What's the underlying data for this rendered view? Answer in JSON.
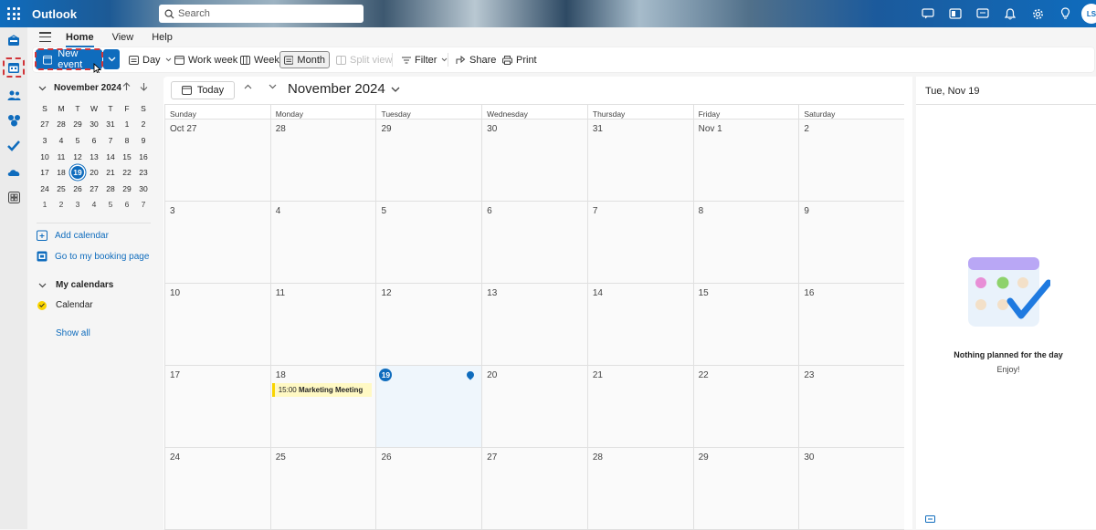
{
  "app": {
    "name": "Outlook"
  },
  "search": {
    "placeholder": "Search"
  },
  "user": {
    "initials": "LS"
  },
  "tabs": [
    {
      "label": "Home"
    },
    {
      "label": "View"
    },
    {
      "label": "Help"
    }
  ],
  "ribbon": {
    "new_event": "New event",
    "day": "Day",
    "work_week": "Work week",
    "week": "Week",
    "month": "Month",
    "split_view": "Split view",
    "filter": "Filter",
    "share": "Share",
    "print": "Print"
  },
  "mini_calendar": {
    "title": "November 2024",
    "weekday_headers": [
      "S",
      "M",
      "T",
      "W",
      "T",
      "F",
      "S"
    ],
    "weeks": [
      [
        "27",
        "28",
        "29",
        "30",
        "31",
        "1",
        "2"
      ],
      [
        "3",
        "4",
        "5",
        "6",
        "7",
        "8",
        "9"
      ],
      [
        "10",
        "11",
        "12",
        "13",
        "14",
        "15",
        "16"
      ],
      [
        "17",
        "18",
        "19",
        "20",
        "21",
        "22",
        "23"
      ],
      [
        "24",
        "25",
        "26",
        "27",
        "28",
        "29",
        "30"
      ],
      [
        "1",
        "2",
        "3",
        "4",
        "5",
        "6",
        "7"
      ]
    ],
    "today": "19"
  },
  "left_links": {
    "add_calendar": "Add calendar",
    "booking_page": "Go to my booking page",
    "my_calendars": "My calendars",
    "calendar": "Calendar",
    "show_all": "Show all"
  },
  "main": {
    "today_button": "Today",
    "month_title": "November 2024",
    "day_headers": [
      "Sunday",
      "Monday",
      "Tuesday",
      "Wednesday",
      "Thursday",
      "Friday",
      "Saturday"
    ],
    "weeks": [
      [
        "Oct 27",
        "28",
        "29",
        "30",
        "31",
        "Nov 1",
        "2"
      ],
      [
        "3",
        "4",
        "5",
        "6",
        "7",
        "8",
        "9"
      ],
      [
        "10",
        "11",
        "12",
        "13",
        "14",
        "15",
        "16"
      ],
      [
        "17",
        "18",
        "19",
        "20",
        "21",
        "22",
        "23"
      ],
      [
        "24",
        "25",
        "26",
        "27",
        "28",
        "29",
        "30"
      ]
    ],
    "today_label": "19",
    "event": {
      "time": "15:00",
      "title": "Marketing Meeting"
    }
  },
  "day_panel": {
    "title": "Tue, Nov 19",
    "empty_title": "Nothing planned for the day",
    "empty_sub": "Enjoy!"
  },
  "colors": {
    "accent": "#0f6cbd",
    "alert": "#d13438",
    "event": "#f9d400"
  }
}
